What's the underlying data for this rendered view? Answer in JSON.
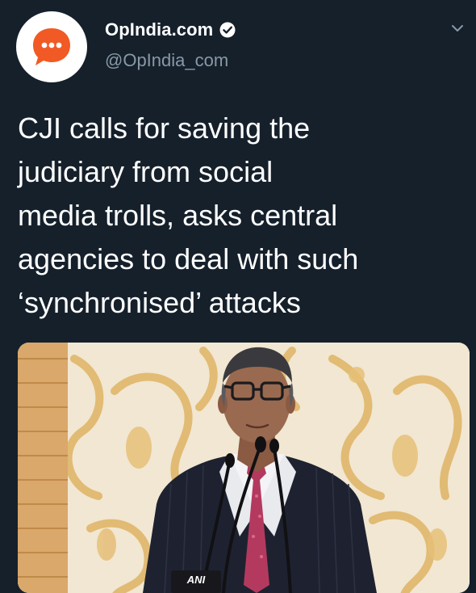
{
  "author": {
    "display_name": "OpIndia.com",
    "handle": "@OpIndia_com",
    "verified": true,
    "avatar_icon": "speech-bubble-icon",
    "avatar_color": "#f15a24"
  },
  "menu_icon": "chevron-down-icon",
  "tweet": {
    "text": "CJI calls for saving the\njudiciary from social\nmedia trolls, asks central\nagencies to deal with such\n‘synchronised’ attacks"
  },
  "media": {
    "image_icon": "news-photo-icon",
    "mic_label": "ANI"
  },
  "colors": {
    "background": "#15202b",
    "primary_text": "#ffffff",
    "secondary_text": "#8899a6"
  }
}
